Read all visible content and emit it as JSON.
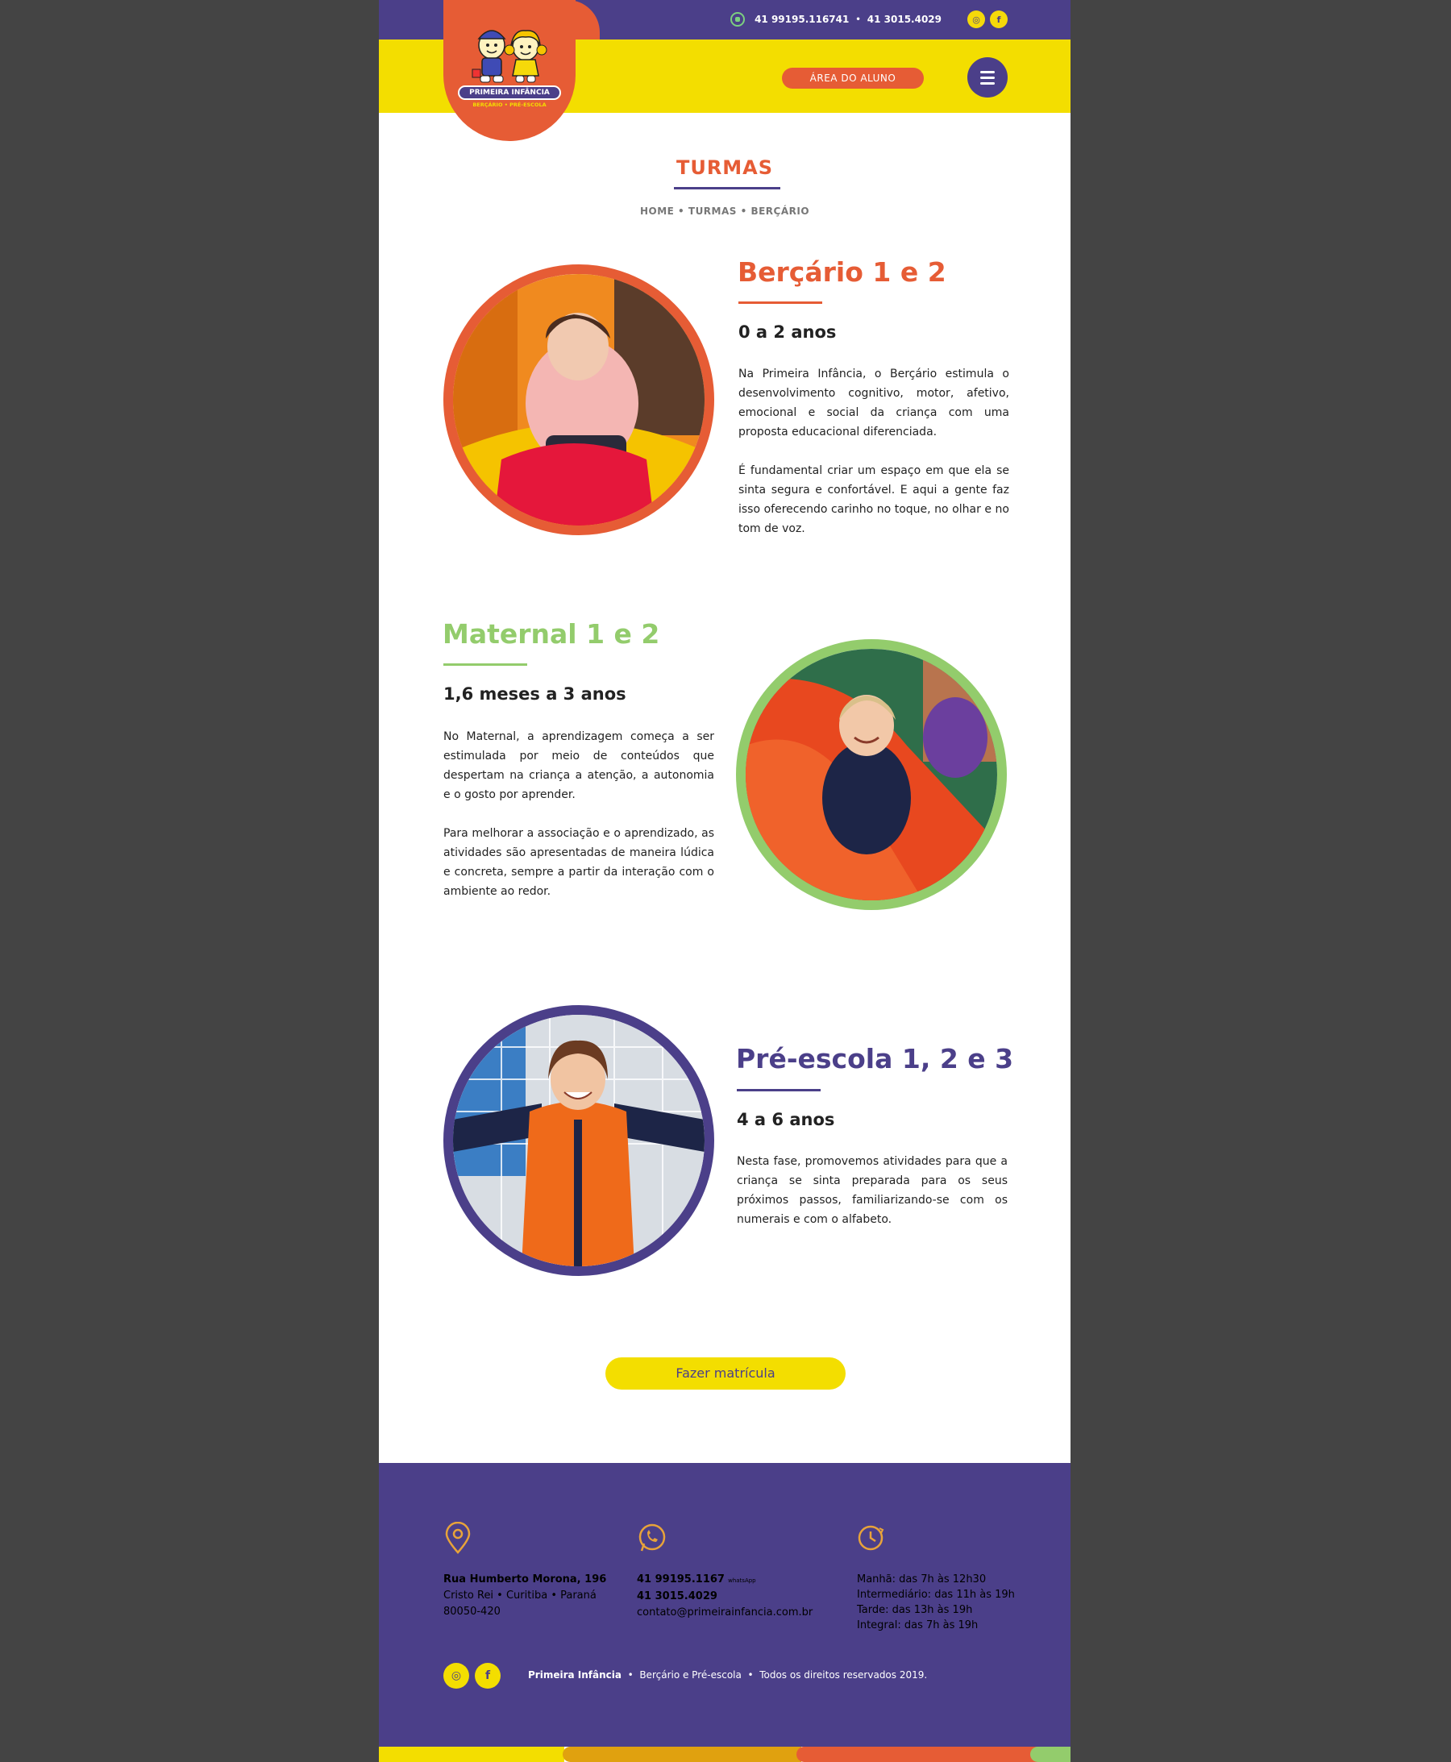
{
  "colors": {
    "purple": "#4b3f89",
    "yellow": "#f3de00",
    "orange": "#e65c35",
    "green": "#93cc6c"
  },
  "header": {
    "phone_whatsapp": "41 99195.116741",
    "separator": "•",
    "phone": "41 3015.4029",
    "social": [
      {
        "icon": "instagram-icon",
        "glyph": "◎"
      },
      {
        "icon": "facebook-icon",
        "glyph": "f"
      }
    ],
    "area_button": "ÁREA DO ALUNO",
    "logo_name": "PRIMEIRA INFÂNCIA",
    "logo_sub": "BERÇÁRIO • PRÉ-ESCOLA"
  },
  "page": {
    "title": "TURMAS",
    "breadcrumb": "HOME • TURMAS • BERÇÁRIO"
  },
  "sections": [
    {
      "title": "Berçário 1 e 2",
      "age": "0 a 2 anos",
      "paragraphs": [
        "Na Primeira Infância, o Berçário estimula o desenvolvimento cognitivo, motor, afetivo, emocional e social da criança com uma proposta educacional diferenciada.",
        "É fundamental criar um espaço em que ela se sinta segura e confortável. E aqui a gente faz isso oferecendo carinho no toque, no olhar e no tom de voz."
      ]
    },
    {
      "title": "Maternal 1 e 2",
      "age": "1,6 meses a  3 anos",
      "paragraphs": [
        "No Maternal, a aprendizagem começa a ser estimulada por meio de conteúdos  que despertam na criança a atenção, a autonomia e o gosto por aprender.",
        "Para melhorar a associação e o aprendizado, as atividades são apresentadas de maneira lúdica e concreta, sempre a partir da interação com o ambiente ao redor."
      ]
    },
    {
      "title": "Pré-escola 1, 2 e 3",
      "age": "4 a 6 anos",
      "paragraphs": [
        "Nesta fase, promovemos atividades para que a criança se sinta preparada para os seus próximos passos, familiarizando-se com os numerais e com o alfabeto."
      ]
    }
  ],
  "cta": "Fazer matrícula",
  "footer": {
    "address": {
      "line1": "Rua Humberto Morona, 196",
      "line2": "Cristo Rei  •  Curitiba  •  Paraná",
      "line3": "80050-420"
    },
    "contact": {
      "whatsapp": "41 99195.1167",
      "whatsapp_tag": "whatsApp",
      "phone": "41 3015.4029",
      "email": "contato@primeirainfancia.com.br"
    },
    "hours": [
      "Manhã: das 7h às 12h30",
      "Intermediário: das 11h às 19h",
      "Tarde: das 13h às 19h",
      "Integral: das 7h às 19h"
    ],
    "brand": "Primeira Infância",
    "brand_sub": "Berçário e Pré-escola",
    "rights": "Todos os direitos reservados 2019.",
    "separator": "•"
  }
}
